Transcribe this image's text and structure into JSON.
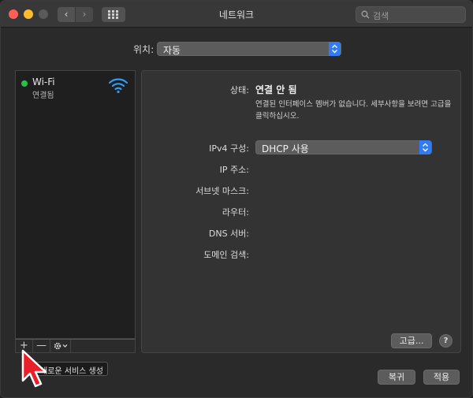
{
  "window": {
    "title": "네트워크"
  },
  "search": {
    "placeholder": "검색"
  },
  "location": {
    "label": "위치:",
    "value": "자동"
  },
  "services": [
    {
      "name": "Wi-Fi",
      "status": "연결됨",
      "status_color": "#29c144"
    }
  ],
  "sidebar_toolbar": {
    "add": "+",
    "remove": "—"
  },
  "tooltip": {
    "text": "새로운 서비스 생성"
  },
  "detail": {
    "status_label": "상태:",
    "status_value": "연결 안 됨",
    "status_description": "연결된 인터페이스 멤버가 없습니다. 세부사항을 보려면 고급을 클릭하십시오.",
    "ipv4_label": "IPv4 구성:",
    "ipv4_value": "DHCP 사용",
    "ip_label": "IP 주소:",
    "subnet_label": "서브넷 마스크:",
    "router_label": "라우터:",
    "dns_label": "DNS 서버:",
    "domain_label": "도메인 검색:",
    "advanced_button": "고급...",
    "help_button": "?"
  },
  "footer": {
    "revert_button": "복귀",
    "apply_button": "적용"
  },
  "colors": {
    "accent": "#2f7cf6",
    "wifi_icon": "#2f9cf6"
  }
}
